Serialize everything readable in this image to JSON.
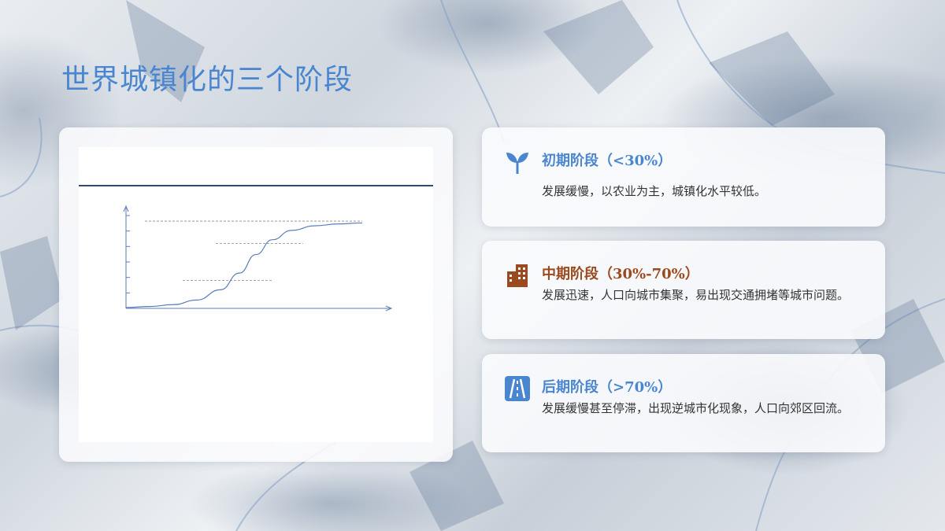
{
  "slide": {
    "title": "世界城镇化的三个阶段"
  },
  "colors": {
    "accent_blue": "#4a86cf",
    "accent_brown": "#9a4a1e",
    "chart_line": "#5b7db8",
    "chart_rule": "#2d4a7c"
  },
  "chart_data": {
    "type": "line",
    "title": "",
    "xlabel": "",
    "ylabel": "",
    "series": [
      {
        "values": [
          [
            0,
            1
          ],
          [
            10,
            2
          ],
          [
            20,
            4
          ],
          [
            30,
            9
          ],
          [
            40,
            20
          ],
          [
            48,
            38
          ],
          [
            55,
            58
          ],
          [
            62,
            74
          ],
          [
            70,
            84
          ],
          [
            80,
            89
          ],
          [
            90,
            91
          ],
          [
            100,
            92
          ]
        ]
      }
    ],
    "reference_lines": [
      94,
      70,
      30
    ],
    "xlim": [
      0,
      110
    ],
    "ylim": [
      0,
      100
    ],
    "y_ticks": 6,
    "grid": false
  },
  "stages": [
    {
      "icon": "sprout-icon",
      "title": "初期阶段（<30%）",
      "desc": "发展缓慢，以农业为主，城镇化水平较低。",
      "color": "#4a86cf"
    },
    {
      "icon": "building-icon",
      "title": "中期阶段（30%-70%）",
      "desc": "发展迅速，人口向城市集聚，易出现交通拥堵等城市问题。",
      "color": "#9a4a1e"
    },
    {
      "icon": "road-icon",
      "title": "后期阶段（>70%）",
      "desc": "发展缓慢甚至停滞，出现逆城市化现象，人口向郊区回流。",
      "color": "#4a86cf"
    }
  ]
}
